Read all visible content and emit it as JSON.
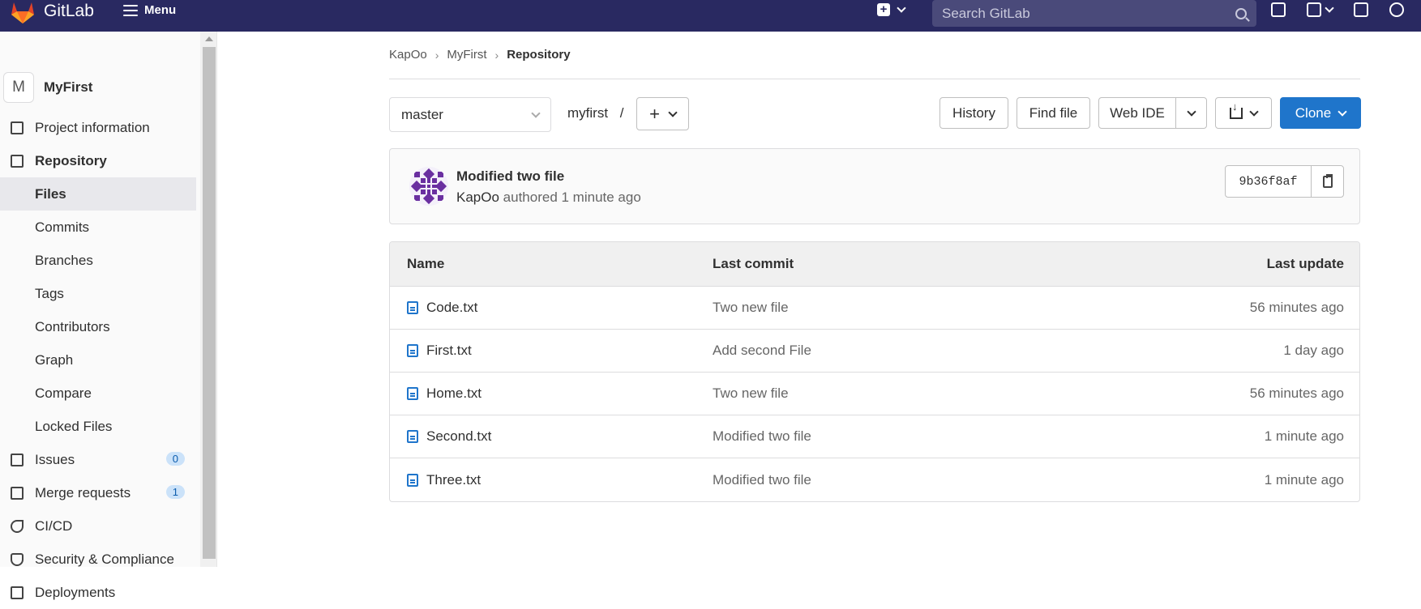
{
  "topbar": {
    "brand": "GitLab",
    "menu_label": "Menu",
    "search_placeholder": "Search GitLab",
    "bg_color": "#292961"
  },
  "sidebar": {
    "project_initial": "M",
    "project_name": "MyFirst",
    "items": [
      {
        "label": "Project information",
        "icon": "info-doc-icon"
      },
      {
        "label": "Repository",
        "icon": "repository-icon"
      },
      {
        "label": "Files"
      },
      {
        "label": "Commits"
      },
      {
        "label": "Branches"
      },
      {
        "label": "Tags"
      },
      {
        "label": "Contributors"
      },
      {
        "label": "Graph"
      },
      {
        "label": "Compare"
      },
      {
        "label": "Locked Files"
      },
      {
        "label": "Issues",
        "icon": "issues-icon",
        "count": "0"
      },
      {
        "label": "Merge requests",
        "icon": "merge-request-icon",
        "count": "1"
      },
      {
        "label": "CI/CD",
        "icon": "rocket-icon"
      },
      {
        "label": "Security & Compliance",
        "icon": "shield-icon"
      },
      {
        "label": "Deployments",
        "icon": "deployments-icon"
      }
    ]
  },
  "breadcrumb": [
    "KapOo",
    "MyFirst",
    "Repository"
  ],
  "toolbar": {
    "branch": "master",
    "path": "myfirst",
    "path_sep": "/",
    "history": "History",
    "find_file": "Find file",
    "web_ide": "Web IDE",
    "clone": "Clone",
    "clone_color": "#1f75cb"
  },
  "last_commit": {
    "title": "Modified two file",
    "author": "KapOo",
    "meta": "authored 1 minute ago",
    "sha": "9b36f8af"
  },
  "files": {
    "headers": [
      "Name",
      "Last commit",
      "Last update"
    ],
    "rows": [
      {
        "name": "Code.txt",
        "commit": "Two new file",
        "updated": "56 minutes ago"
      },
      {
        "name": "First.txt",
        "commit": "Add second File",
        "updated": "1 day ago"
      },
      {
        "name": "Home.txt",
        "commit": "Two new file",
        "updated": "56 minutes ago"
      },
      {
        "name": "Second.txt",
        "commit": "Modified two file",
        "updated": "1 minute ago"
      },
      {
        "name": "Three.txt",
        "commit": "Modified two file",
        "updated": "1 minute ago"
      }
    ]
  }
}
